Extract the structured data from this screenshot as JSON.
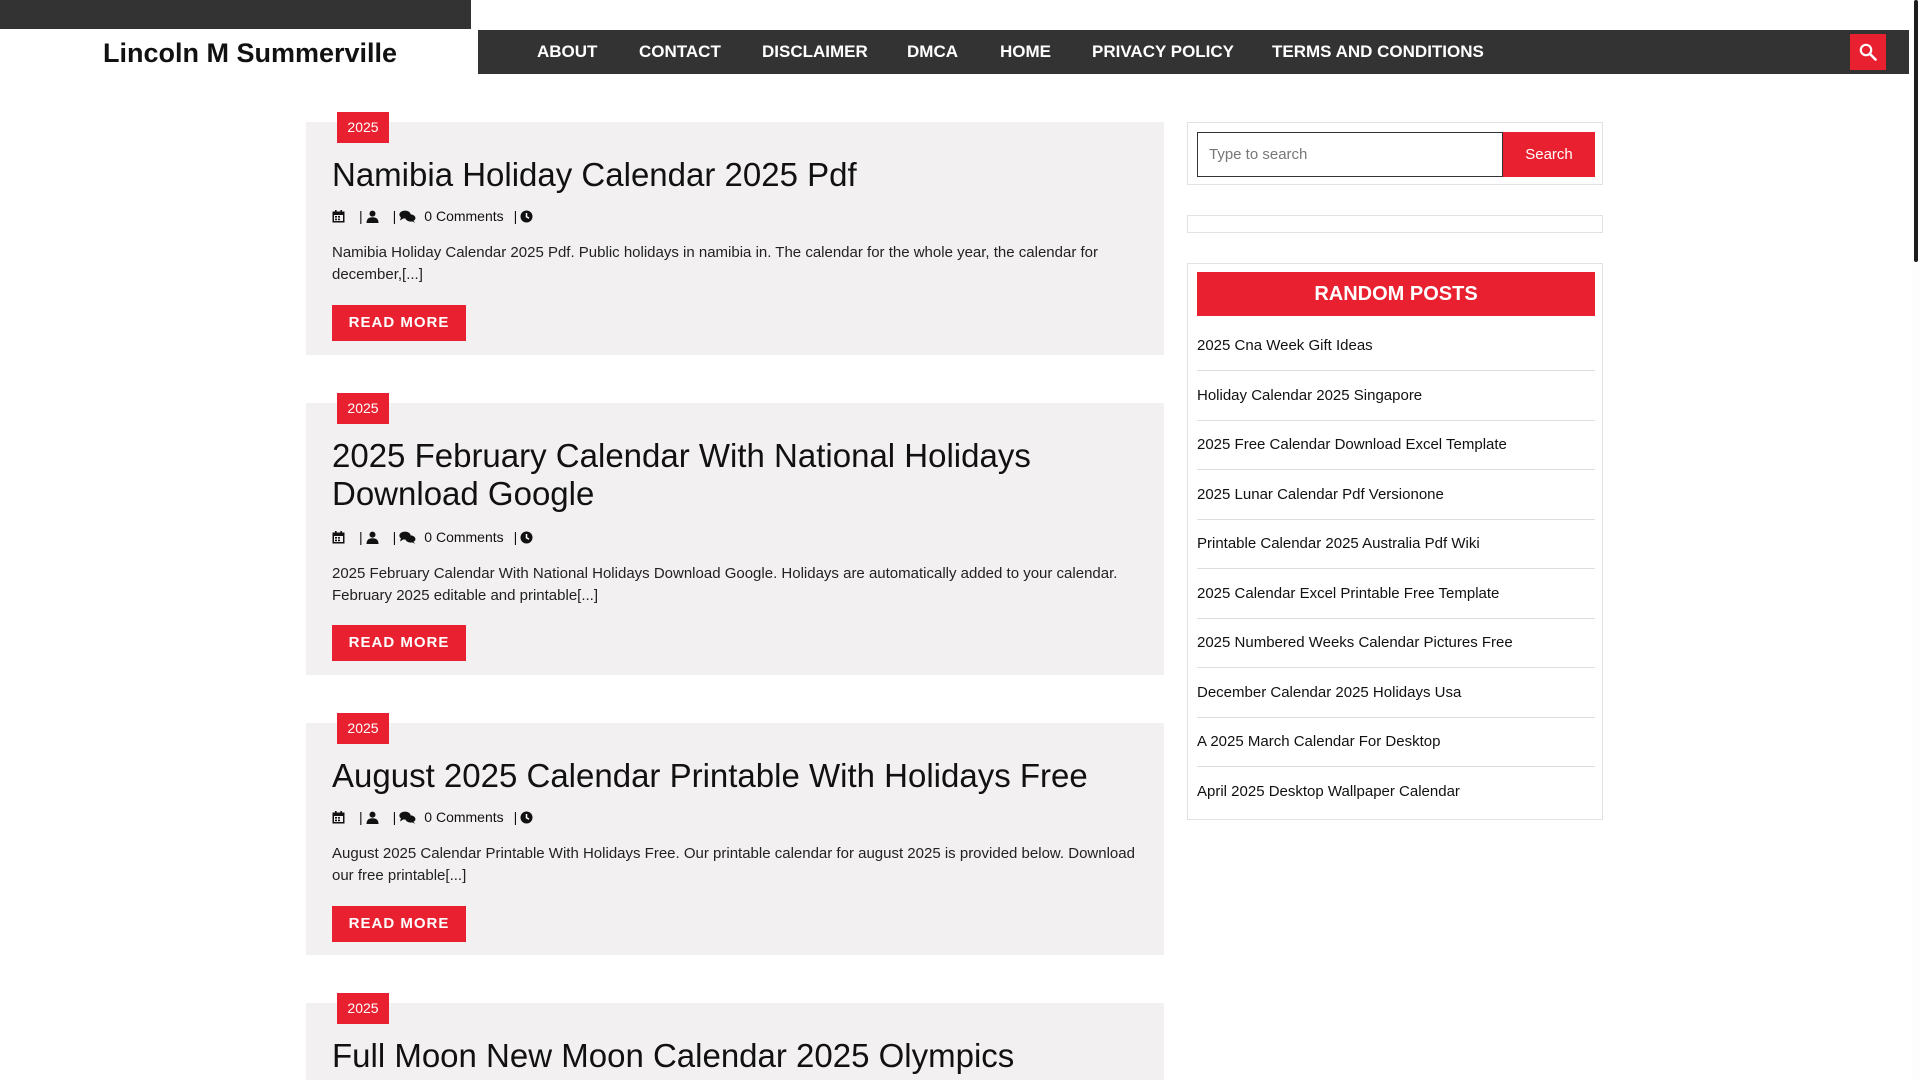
{
  "site": {
    "title": "Lincoln M Summerville"
  },
  "nav": {
    "items": [
      {
        "label": "ABOUT"
      },
      {
        "label": "CONTACT"
      },
      {
        "label": "DISCLAIMER"
      },
      {
        "label": "DMCA"
      },
      {
        "label": "HOME"
      },
      {
        "label": "PRIVACY POLICY"
      },
      {
        "label": "TERMS AND CONDITIONS"
      }
    ],
    "search_icon": "search-icon"
  },
  "colors": {
    "accent": "#e8202f",
    "nav_bg": "#333333",
    "post_bg": "#f2f0f0"
  },
  "posts": [
    {
      "category": "2025",
      "title": "Namibia Holiday Calendar 2025 Pdf",
      "comments": "0 Comments",
      "excerpt": "Namibia Holiday Calendar 2025 Pdf. Public holidays in namibia in. The calendar for the whole year, the calendar for december,[...]",
      "read_more": "READ MORE"
    },
    {
      "category": "2025",
      "title": "2025 February Calendar With National Holidays Download Google",
      "comments": "0 Comments",
      "excerpt": "2025 February Calendar With National Holidays Download Google. Holidays are automatically added to your calendar. February 2025 editable and printable[...]",
      "read_more": "READ MORE"
    },
    {
      "category": "2025",
      "title": "August 2025 Calendar Printable With Holidays Free",
      "comments": "0 Comments",
      "excerpt": "August 2025 Calendar Printable With Holidays Free. Our printable calendar for august 2025 is provided below. Download our free printable[...]",
      "read_more": "READ MORE"
    },
    {
      "category": "2025",
      "title": "Full Moon New Moon Calendar 2025 Olympics"
    }
  ],
  "sidebar": {
    "search": {
      "placeholder": "Type to search",
      "button": "Search"
    },
    "random_posts": {
      "title": "RANDOM POSTS",
      "items": [
        "2025 Cna Week Gift Ideas",
        "Holiday Calendar 2025 Singapore",
        "2025 Free Calendar Download Excel Template",
        "2025 Lunar Calendar Pdf Versionone",
        "Printable Calendar 2025 Australia Pdf Wiki",
        "2025 Calendar Excel Printable Free Template",
        "2025 Numbered Weeks Calendar Pictures Free",
        "December Calendar 2025 Holidays Usa",
        "A 2025 March Calendar For Desktop",
        "April 2025 Desktop Wallpaper Calendar"
      ]
    }
  }
}
